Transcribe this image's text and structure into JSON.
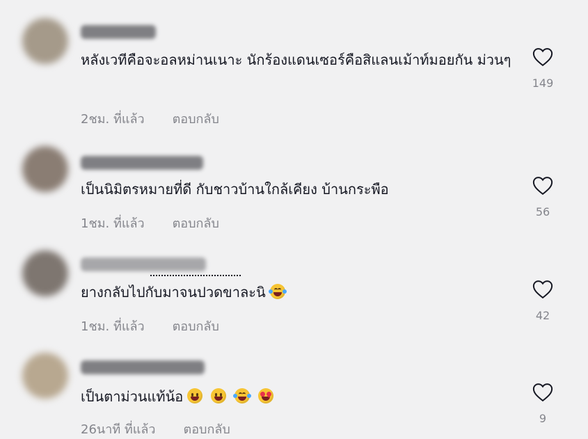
{
  "comments": [
    {
      "avatar_color": "#a59a8a",
      "username_width": 108,
      "text": "หลังเวทีคือจะอลหม่านเนาะ นักร้องแดนเซอร์คือสิแลนเม้าท์มอยกัน ม่วนๆ",
      "time": "2ชม. ที่แล้ว",
      "reply": "ตอบกลับ",
      "likes": "149",
      "emojis": []
    },
    {
      "avatar_color": "#8a7d73",
      "username_width": 176,
      "text": "เป็นนิมิตรหมายที่ดี กับชาวบ้านใกล้เคียง บ้านกระพือ",
      "time": "1ชม. ที่แล้ว",
      "reply": "ตอบกลับ",
      "likes": "56",
      "emojis": []
    },
    {
      "avatar_color": "#7e7670",
      "username_width": 180,
      "text": "ยางกลับไปกับมาจนปวดขาละนิ",
      "time": "1ชม. ที่แล้ว",
      "reply": "ตอบกลับ",
      "likes": "42",
      "emojis": [
        "laugh"
      ]
    },
    {
      "avatar_color": "#b8a890",
      "username_width": 178,
      "text": "เป็นตาม่วนแท้น้อ",
      "time": "26นาที ที่แล้ว",
      "reply": "ตอบกลับ",
      "likes": "9",
      "emojis": [
        "grin",
        "grin",
        "laugh",
        "heart"
      ]
    }
  ]
}
